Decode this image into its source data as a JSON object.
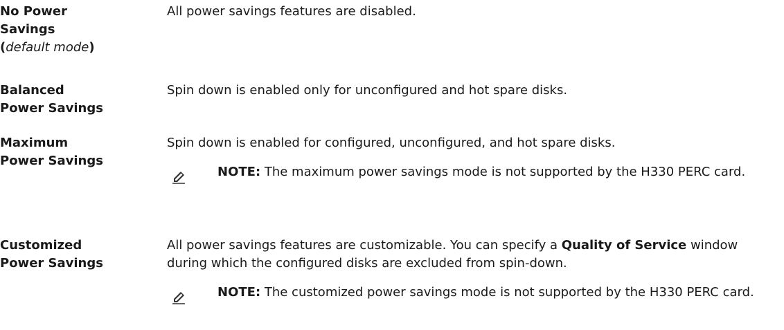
{
  "modes": [
    {
      "term_lines": [
        "No Power",
        "Savings"
      ],
      "term_paren_open": "(",
      "term_paren_text": "default mode",
      "term_paren_close": ")",
      "description": "All power savings features are disabled."
    },
    {
      "term_lines": [
        "Balanced",
        "Power Savings"
      ],
      "description": "Spin down is enabled only for unconfigured and hot spare disks."
    },
    {
      "term_lines": [
        "Maximum",
        "Power Savings"
      ],
      "description": "Spin down is enabled for configured, unconfigured, and hot spare disks.",
      "note": {
        "label": "NOTE:",
        "text": " The maximum power savings mode is not supported by the H330 PERC card.",
        "icon": "pencil-note-icon"
      }
    },
    {
      "term_lines": [
        "Customized",
        "Power Savings"
      ],
      "description_before": "All power savings features are customizable. You can specify a ",
      "description_bold": "Quality of Service",
      "description_after": " window during which the configured disks are excluded from spin-down.",
      "note": {
        "label": "NOTE:",
        "text": " The customized power savings mode is not supported by the H330 PERC card.",
        "icon": "pencil-note-icon"
      }
    }
  ],
  "colors": {
    "text": "#1a1a1a",
    "icon": "#333333",
    "background": "#ffffff"
  }
}
